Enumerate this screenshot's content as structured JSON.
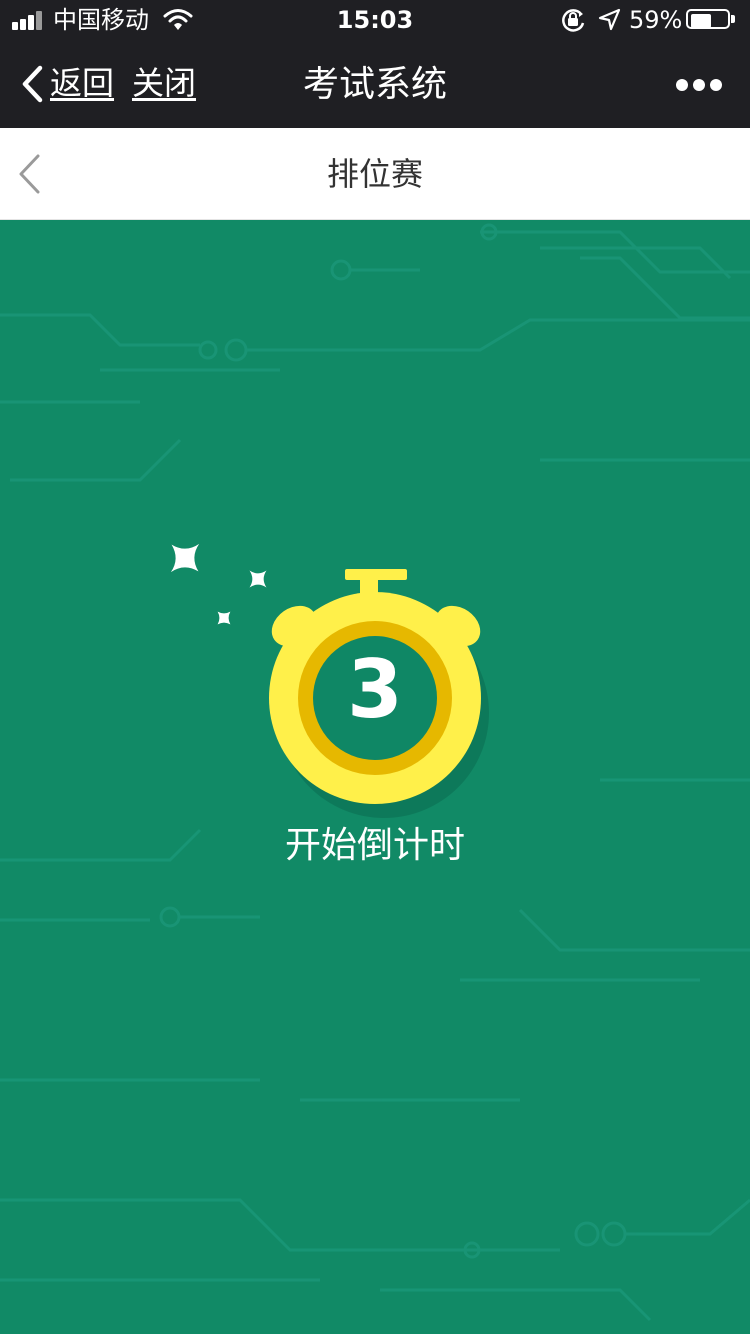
{
  "status_bar": {
    "carrier": "中国移动",
    "time": "15:03",
    "battery_percent": "59%",
    "battery_level": 0.59,
    "icons": [
      "signal-icon",
      "wifi-icon",
      "orientation-lock-icon",
      "location-icon",
      "battery-icon"
    ]
  },
  "wechat_nav": {
    "back_label": "返回",
    "close_label": "关闭",
    "title": "考试系统",
    "more_icon": "more-dots-icon"
  },
  "page_header": {
    "back_icon": "chevron-left-icon",
    "title": "排位赛"
  },
  "countdown": {
    "number": "3",
    "label": "开始倒计时",
    "icon": "stopwatch-icon"
  },
  "colors": {
    "nav_background": "#1f1f23",
    "content_background": "#118a66",
    "stopwatch_yellow": "#fff04a",
    "stopwatch_ring": "#e6b800",
    "text_white": "#ffffff"
  }
}
